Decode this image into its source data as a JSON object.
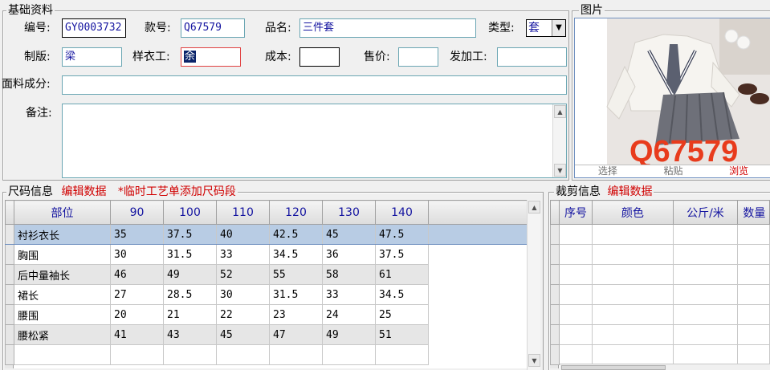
{
  "basic": {
    "title": "基础资料",
    "labels": {
      "code": "编号:",
      "style_no": "款号:",
      "product_name": "品名:",
      "type": "类型:",
      "pattern": "制版:",
      "sample_worker": "样衣工:",
      "cost": "成本:",
      "price": "售价:",
      "process": "发加工:",
      "fabric": "面料成分:",
      "remark": "备注:"
    },
    "values": {
      "code": "GY0003732",
      "style_no": "Q67579",
      "product_name": "三件套",
      "type": "套",
      "pattern": "梁",
      "sample_worker": "余",
      "cost": "",
      "price": "",
      "process": "",
      "fabric": "",
      "remark": ""
    }
  },
  "picture": {
    "title": "图片",
    "watermark": "Q67579",
    "links": [
      "选择",
      "粘贴",
      "浏览"
    ]
  },
  "size_info": {
    "title": "尺码信息",
    "edit_link": "编辑数据",
    "note": "*临时工艺单添加尺码段",
    "columns": [
      "部位",
      "90",
      "100",
      "110",
      "120",
      "130",
      "140"
    ],
    "rows": [
      [
        "衬衫衣长",
        "35",
        "37.5",
        "40",
        "42.5",
        "45",
        "47.5"
      ],
      [
        "胸围",
        "30",
        "31.5",
        "33",
        "34.5",
        "36",
        "37.5"
      ],
      [
        "后中量袖长",
        "46",
        "49",
        "52",
        "55",
        "58",
        "61"
      ],
      [
        "裙长",
        "27",
        "28.5",
        "30",
        "31.5",
        "33",
        "34.5"
      ],
      [
        "腰围",
        "20",
        "21",
        "22",
        "23",
        "24",
        "25"
      ],
      [
        "腰松紧",
        "41",
        "43",
        "45",
        "47",
        "49",
        "51"
      ]
    ]
  },
  "cut_info": {
    "title": "裁剪信息",
    "edit_link": "编辑数据",
    "columns": [
      "序号",
      "颜色",
      "公斤/米",
      "数量"
    ]
  },
  "colors": {
    "accent_red": "#d00000",
    "field_text": "#1414a0",
    "selected_row": "#b8cce4"
  }
}
